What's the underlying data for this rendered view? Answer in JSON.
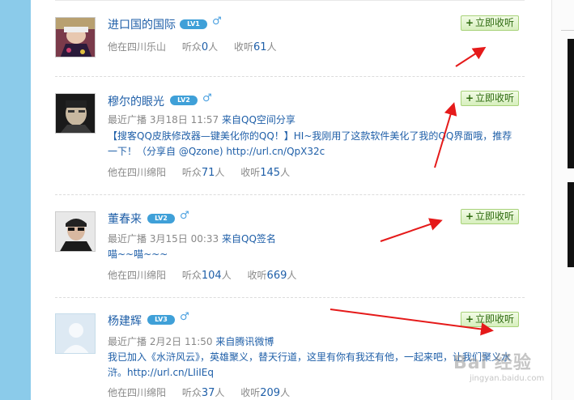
{
  "accent_color": "#1f5fa8",
  "listen_button": {
    "plus": "+",
    "label": "立即收听"
  },
  "users": [
    {
      "name": "进口国的国际",
      "level": "LV1",
      "gender_icon": "male-icon",
      "meta": null,
      "post": null,
      "location": "他在四川乐山",
      "listeners_label": "听众",
      "listeners": "0",
      "listeners_unit": "人",
      "following_label": "收听",
      "following": "61",
      "following_unit": "人"
    },
    {
      "name": "穆尔的眼光",
      "level": "LV2",
      "gender_icon": "male-icon",
      "meta": {
        "label": "最近广播",
        "date": "3月18日",
        "time": "11:57",
        "source": "来自QQ空间分享"
      },
      "post": "【搜客QQ皮肤修改器—键美化你的QQ！】HI~我刚用了这款软件美化了我的QQ界面哦，推荐一下！（分享自 @Qzone) http://url.cn/QpX32c",
      "location": "他在四川绵阳",
      "listeners_label": "听众",
      "listeners": "71",
      "listeners_unit": "人",
      "following_label": "收听",
      "following": "145",
      "following_unit": "人"
    },
    {
      "name": "董春来",
      "level": "LV2",
      "gender_icon": "male-icon",
      "meta": {
        "label": "最近广播",
        "date": "3月15日",
        "time": "00:33",
        "source": "来自QQ签名"
      },
      "post": "喵~~喵~~~",
      "location": "他在四川绵阳",
      "listeners_label": "听众",
      "listeners": "104",
      "listeners_unit": "人",
      "following_label": "收听",
      "following": "669",
      "following_unit": "人"
    },
    {
      "name": "杨建辉",
      "level": "LV3",
      "gender_icon": "male-icon",
      "meta": {
        "label": "最近广播",
        "date": "2月2日",
        "time": "11:50",
        "source": "来自腾讯微博"
      },
      "post": "我已加入《水浒风云》，英雄聚义，替天行道，这里有你有我还有他，一起来吧，让我们聚义水浒。http://url.cn/LIiIEq",
      "location": "他在四川绵阳",
      "listeners_label": "听众",
      "listeners": "37",
      "listeners_unit": "人",
      "following_label": "收听",
      "following": "209",
      "following_unit": "人"
    }
  ],
  "watermark": {
    "text": "Bai 经验",
    "url": "jingyan.baidu.com"
  }
}
